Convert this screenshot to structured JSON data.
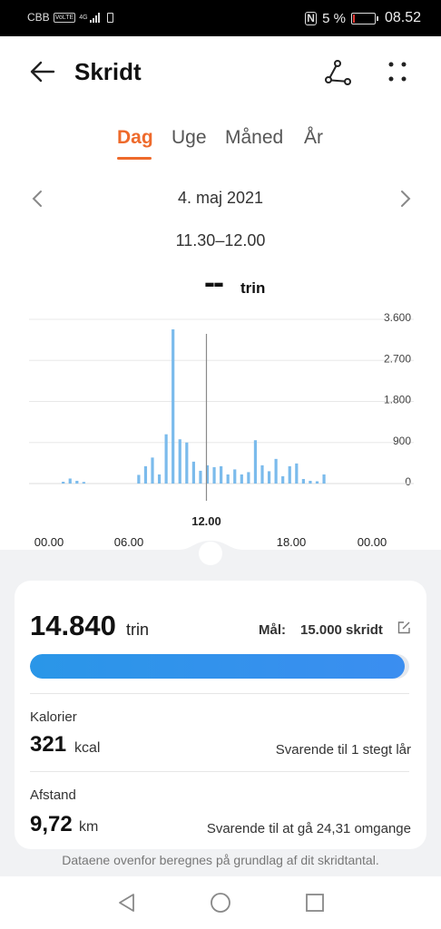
{
  "status_bar": {
    "carrier": "CBB",
    "volte": "VoLTE",
    "network": "4G",
    "nfc": "N",
    "battery_pct": "5 %",
    "battery_level": 0.05,
    "time": "08.52"
  },
  "app_bar": {
    "back_icon": "arrow-left-icon",
    "title": "Skridt",
    "share_icon": "share-icon",
    "more_icon": "more-dots-icon"
  },
  "tabs": [
    {
      "label": "Dag",
      "active": true
    },
    {
      "label": "Uge",
      "active": false
    },
    {
      "label": "Måned",
      "active": false
    },
    {
      "label": "År",
      "active": false
    }
  ],
  "date_nav": {
    "date": "4. maj 2021",
    "prev_icon": "chevron-left-icon",
    "next_icon": "chevron-right-icon"
  },
  "selection": {
    "time_range": "11.30–12.00",
    "value": "--",
    "unit": "trin"
  },
  "chart_data": {
    "type": "bar",
    "y_ticks": [
      "3.600",
      "2.700",
      "1.800",
      "900",
      "0"
    ],
    "y_tick_values": [
      3600,
      2700,
      1800,
      900,
      0
    ],
    "ylim": [
      0,
      3600
    ],
    "x_ticks": [
      "00.00",
      "06.00",
      "12.00",
      "18.00",
      "00.00"
    ],
    "x_tick_hours": [
      0,
      6,
      12,
      18,
      24
    ],
    "selected_label": "12.00",
    "selected_hour": 12,
    "bar_color": "#7bbbec",
    "grid": true,
    "interval_minutes": 30,
    "bars": [
      {
        "t": 1.5,
        "v": 40
      },
      {
        "t": 2.0,
        "v": 110
      },
      {
        "t": 2.5,
        "v": 60
      },
      {
        "t": 3.0,
        "v": 35
      },
      {
        "t": 7.0,
        "v": 190
      },
      {
        "t": 7.5,
        "v": 380
      },
      {
        "t": 8.0,
        "v": 570
      },
      {
        "t": 8.5,
        "v": 200
      },
      {
        "t": 9.0,
        "v": 1080
      },
      {
        "t": 9.5,
        "v": 3380
      },
      {
        "t": 10.0,
        "v": 970
      },
      {
        "t": 10.5,
        "v": 900
      },
      {
        "t": 11.0,
        "v": 480
      },
      {
        "t": 11.5,
        "v": 280
      },
      {
        "t": 12.0,
        "v": 400
      },
      {
        "t": 12.5,
        "v": 360
      },
      {
        "t": 13.0,
        "v": 380
      },
      {
        "t": 13.5,
        "v": 200
      },
      {
        "t": 14.0,
        "v": 310
      },
      {
        "t": 14.5,
        "v": 200
      },
      {
        "t": 15.0,
        "v": 250
      },
      {
        "t": 15.5,
        "v": 950
      },
      {
        "t": 16.0,
        "v": 400
      },
      {
        "t": 16.5,
        "v": 270
      },
      {
        "t": 17.0,
        "v": 540
      },
      {
        "t": 17.5,
        "v": 160
      },
      {
        "t": 18.0,
        "v": 380
      },
      {
        "t": 18.5,
        "v": 440
      },
      {
        "t": 19.0,
        "v": 100
      },
      {
        "t": 19.5,
        "v": 60
      },
      {
        "t": 20.0,
        "v": 50
      },
      {
        "t": 20.5,
        "v": 200
      }
    ]
  },
  "summary": {
    "steps_value": "14.840",
    "steps_unit": "trin",
    "goal_label": "Mål:",
    "goal_value": "15.000 skridt",
    "edit_icon": "edit-icon",
    "progress": 0.989,
    "progress_color": "#2f93ee",
    "calories_label": "Kalorier",
    "calories_value": "321",
    "calories_unit": "kcal",
    "calories_note": "Svarende til 1 stegt lår",
    "distance_label": "Afstand",
    "distance_value": "9,72",
    "distance_unit": "km",
    "distance_note": "Svarende til at gå 24,31 omgange"
  },
  "footnote": "Dataene ovenfor beregnes på grundlag af dit skridtantal.",
  "nav_bar": {
    "back": "triangle-back-icon",
    "home": "circle-home-icon",
    "recents": "square-recents-icon"
  },
  "colors": {
    "accent": "#ee6a2b",
    "progress": "#2f93ee",
    "bar": "#7bbbec"
  }
}
